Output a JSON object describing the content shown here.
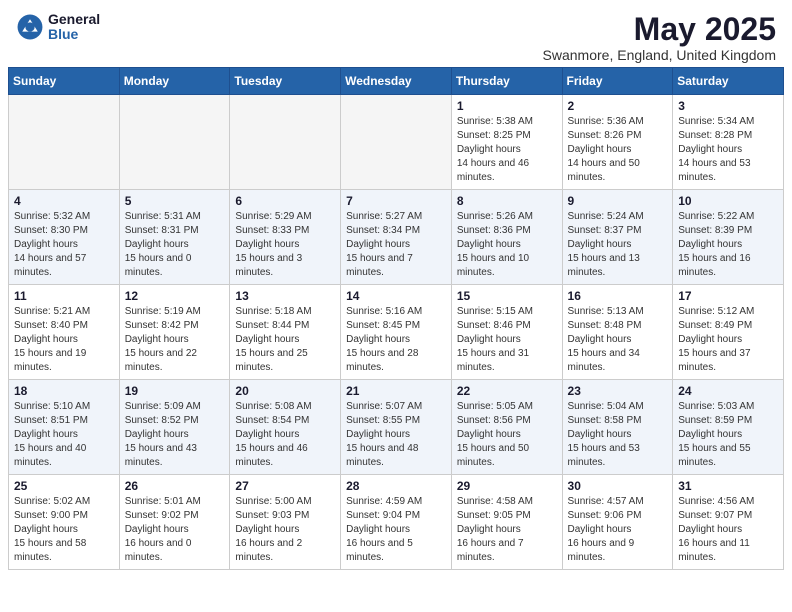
{
  "header": {
    "logo_general": "General",
    "logo_blue": "Blue",
    "month_title": "May 2025",
    "location": "Swanmore, England, United Kingdom"
  },
  "weekdays": [
    "Sunday",
    "Monday",
    "Tuesday",
    "Wednesday",
    "Thursday",
    "Friday",
    "Saturday"
  ],
  "weeks": [
    [
      {
        "day": "",
        "empty": true
      },
      {
        "day": "",
        "empty": true
      },
      {
        "day": "",
        "empty": true
      },
      {
        "day": "",
        "empty": true
      },
      {
        "day": "1",
        "sunrise": "5:38 AM",
        "sunset": "8:25 PM",
        "daylight": "14 hours and 46 minutes."
      },
      {
        "day": "2",
        "sunrise": "5:36 AM",
        "sunset": "8:26 PM",
        "daylight": "14 hours and 50 minutes."
      },
      {
        "day": "3",
        "sunrise": "5:34 AM",
        "sunset": "8:28 PM",
        "daylight": "14 hours and 53 minutes."
      }
    ],
    [
      {
        "day": "4",
        "sunrise": "5:32 AM",
        "sunset": "8:30 PM",
        "daylight": "14 hours and 57 minutes."
      },
      {
        "day": "5",
        "sunrise": "5:31 AM",
        "sunset": "8:31 PM",
        "daylight": "15 hours and 0 minutes."
      },
      {
        "day": "6",
        "sunrise": "5:29 AM",
        "sunset": "8:33 PM",
        "daylight": "15 hours and 3 minutes."
      },
      {
        "day": "7",
        "sunrise": "5:27 AM",
        "sunset": "8:34 PM",
        "daylight": "15 hours and 7 minutes."
      },
      {
        "day": "8",
        "sunrise": "5:26 AM",
        "sunset": "8:36 PM",
        "daylight": "15 hours and 10 minutes."
      },
      {
        "day": "9",
        "sunrise": "5:24 AM",
        "sunset": "8:37 PM",
        "daylight": "15 hours and 13 minutes."
      },
      {
        "day": "10",
        "sunrise": "5:22 AM",
        "sunset": "8:39 PM",
        "daylight": "15 hours and 16 minutes."
      }
    ],
    [
      {
        "day": "11",
        "sunrise": "5:21 AM",
        "sunset": "8:40 PM",
        "daylight": "15 hours and 19 minutes."
      },
      {
        "day": "12",
        "sunrise": "5:19 AM",
        "sunset": "8:42 PM",
        "daylight": "15 hours and 22 minutes."
      },
      {
        "day": "13",
        "sunrise": "5:18 AM",
        "sunset": "8:44 PM",
        "daylight": "15 hours and 25 minutes."
      },
      {
        "day": "14",
        "sunrise": "5:16 AM",
        "sunset": "8:45 PM",
        "daylight": "15 hours and 28 minutes."
      },
      {
        "day": "15",
        "sunrise": "5:15 AM",
        "sunset": "8:46 PM",
        "daylight": "15 hours and 31 minutes."
      },
      {
        "day": "16",
        "sunrise": "5:13 AM",
        "sunset": "8:48 PM",
        "daylight": "15 hours and 34 minutes."
      },
      {
        "day": "17",
        "sunrise": "5:12 AM",
        "sunset": "8:49 PM",
        "daylight": "15 hours and 37 minutes."
      }
    ],
    [
      {
        "day": "18",
        "sunrise": "5:10 AM",
        "sunset": "8:51 PM",
        "daylight": "15 hours and 40 minutes."
      },
      {
        "day": "19",
        "sunrise": "5:09 AM",
        "sunset": "8:52 PM",
        "daylight": "15 hours and 43 minutes."
      },
      {
        "day": "20",
        "sunrise": "5:08 AM",
        "sunset": "8:54 PM",
        "daylight": "15 hours and 46 minutes."
      },
      {
        "day": "21",
        "sunrise": "5:07 AM",
        "sunset": "8:55 PM",
        "daylight": "15 hours and 48 minutes."
      },
      {
        "day": "22",
        "sunrise": "5:05 AM",
        "sunset": "8:56 PM",
        "daylight": "15 hours and 50 minutes."
      },
      {
        "day": "23",
        "sunrise": "5:04 AM",
        "sunset": "8:58 PM",
        "daylight": "15 hours and 53 minutes."
      },
      {
        "day": "24",
        "sunrise": "5:03 AM",
        "sunset": "8:59 PM",
        "daylight": "15 hours and 55 minutes."
      }
    ],
    [
      {
        "day": "25",
        "sunrise": "5:02 AM",
        "sunset": "9:00 PM",
        "daylight": "15 hours and 58 minutes."
      },
      {
        "day": "26",
        "sunrise": "5:01 AM",
        "sunset": "9:02 PM",
        "daylight": "16 hours and 0 minutes."
      },
      {
        "day": "27",
        "sunrise": "5:00 AM",
        "sunset": "9:03 PM",
        "daylight": "16 hours and 2 minutes."
      },
      {
        "day": "28",
        "sunrise": "4:59 AM",
        "sunset": "9:04 PM",
        "daylight": "16 hours and 5 minutes."
      },
      {
        "day": "29",
        "sunrise": "4:58 AM",
        "sunset": "9:05 PM",
        "daylight": "16 hours and 7 minutes."
      },
      {
        "day": "30",
        "sunrise": "4:57 AM",
        "sunset": "9:06 PM",
        "daylight": "16 hours and 9 minutes."
      },
      {
        "day": "31",
        "sunrise": "4:56 AM",
        "sunset": "9:07 PM",
        "daylight": "16 hours and 11 minutes."
      }
    ]
  ]
}
